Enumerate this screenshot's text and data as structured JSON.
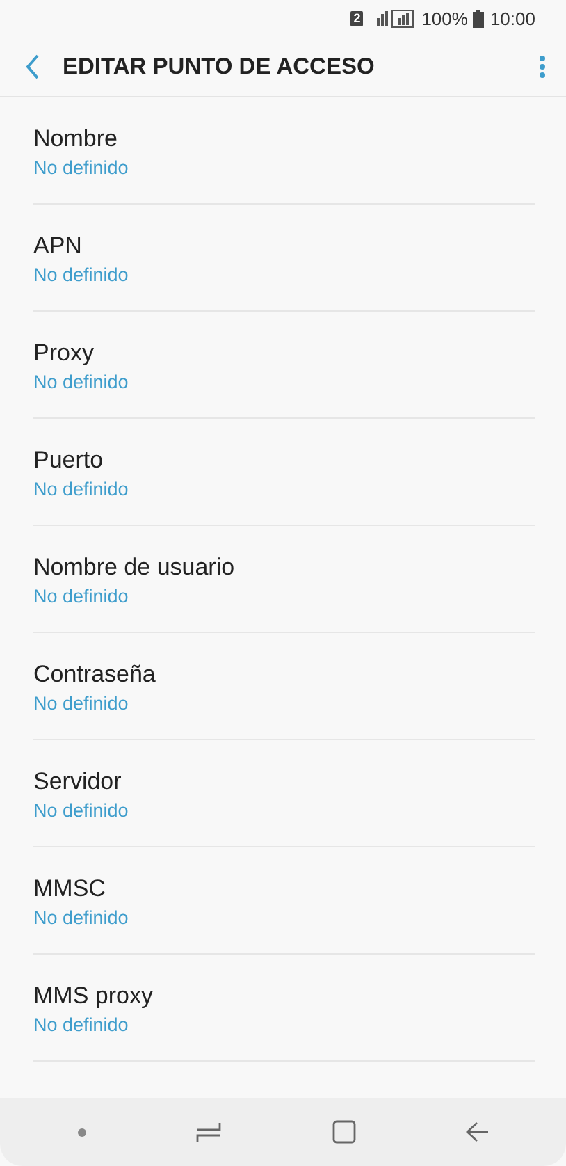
{
  "status_bar": {
    "sim": "2",
    "battery_text": "100%",
    "time": "10:00"
  },
  "header": {
    "title": "EDITAR PUNTO DE ACCESO"
  },
  "settings": [
    {
      "label": "Nombre",
      "value": "No definido"
    },
    {
      "label": "APN",
      "value": "No definido"
    },
    {
      "label": "Proxy",
      "value": "No definido"
    },
    {
      "label": "Puerto",
      "value": "No definido"
    },
    {
      "label": "Nombre de usuario",
      "value": "No definido"
    },
    {
      "label": "Contraseña",
      "value": "No definido"
    },
    {
      "label": "Servidor",
      "value": "No definido"
    },
    {
      "label": "MMSC",
      "value": "No definido"
    },
    {
      "label": "MMS proxy",
      "value": "No definido"
    }
  ]
}
